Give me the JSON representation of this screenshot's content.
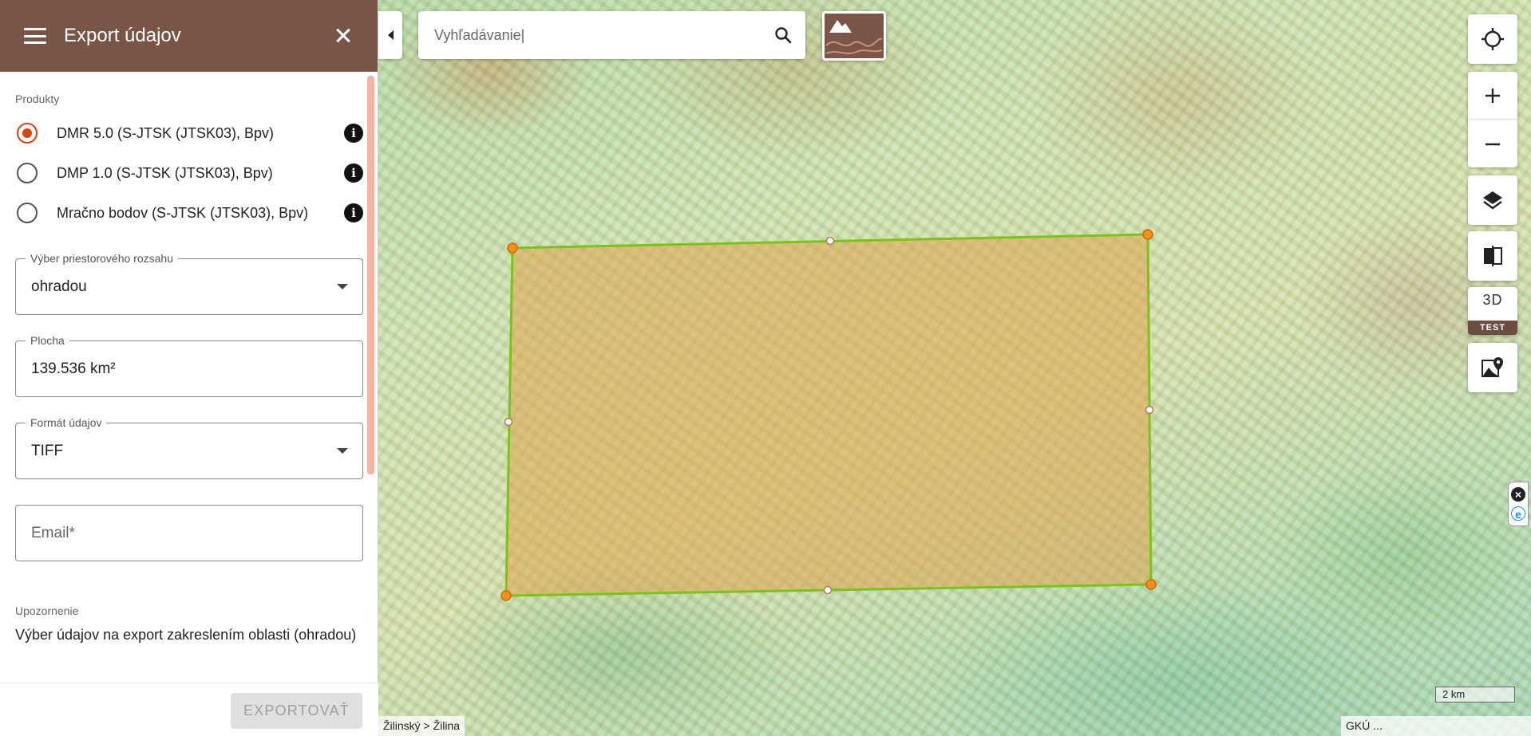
{
  "panel": {
    "title": "Export údajov",
    "products_label": "Produkty",
    "products": [
      {
        "label": "DMR 5.0 (S-JTSK (JTSK03), Bpv)",
        "selected": true
      },
      {
        "label": "DMP 1.0 (S-JTSK (JTSK03), Bpv)",
        "selected": false
      },
      {
        "label": "Mračno bodov (S-JTSK (JTSK03), Bpv)",
        "selected": false
      }
    ],
    "extent": {
      "label": "Výber priestorového rozsahu",
      "value": "ohradou"
    },
    "area": {
      "label": "Plocha",
      "value": "139.536 km²"
    },
    "format": {
      "label": "Formát údajov",
      "value": "TIFF"
    },
    "email": {
      "label": "Email*"
    },
    "warning": {
      "label": "Upozornenie",
      "text": "Výber údajov na export zakreslením oblasti (ohradou)"
    },
    "export_button": "EXPORTOVAŤ"
  },
  "search": {
    "placeholder": "Vyhľadávanie|"
  },
  "controls": {
    "three_d_label": "3D",
    "test_badge": "TEST"
  },
  "map": {
    "scale_label": "2 km",
    "breadcrumb": "Žilinský > Žilina",
    "attribution": "GKÚ ...",
    "selection_fill": "#e0a24a",
    "selection_stroke": "#7cc21f",
    "vertex_color": "#f5901e"
  },
  "colors": {
    "header": "#795548",
    "radio_accent": "#d84315"
  }
}
